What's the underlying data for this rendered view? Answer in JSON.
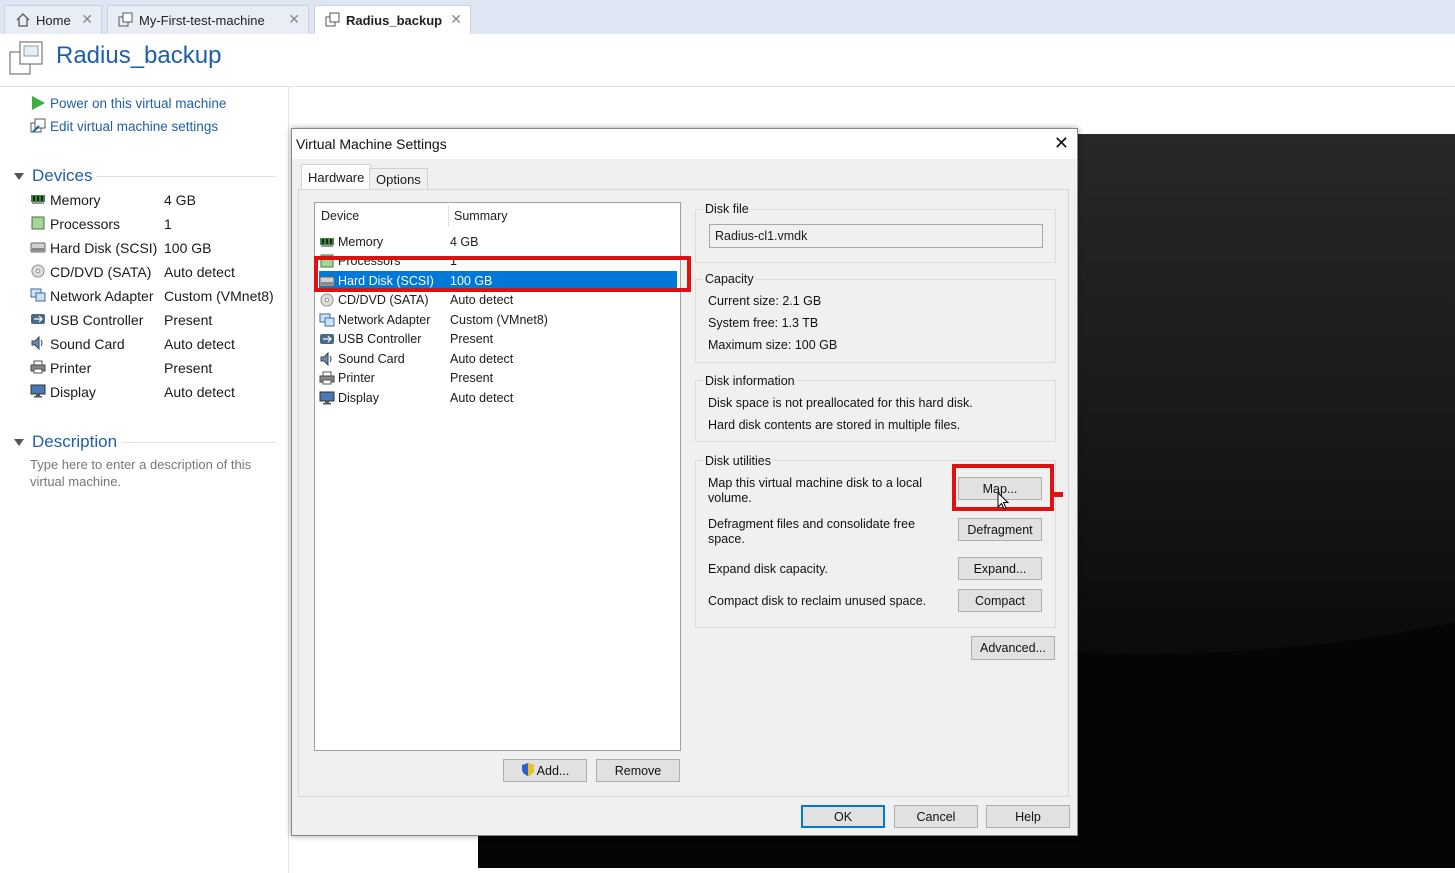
{
  "tabs": [
    {
      "label": "Home",
      "icon": "home-icon"
    },
    {
      "label": "My-First-test-machine",
      "icon": "vm-icon"
    },
    {
      "label": "Radius_backup",
      "icon": "vm-icon",
      "active": true
    }
  ],
  "vm_title": "Radius_backup",
  "actions": {
    "power_on": "Power on this virtual machine",
    "edit_settings": "Edit virtual machine settings"
  },
  "devices_section": {
    "title": "Devices",
    "items": [
      {
        "name": "Memory",
        "value": "4 GB",
        "icon": "memory-icon"
      },
      {
        "name": "Processors",
        "value": "1",
        "icon": "processor-icon"
      },
      {
        "name": "Hard Disk (SCSI)",
        "value": "100 GB",
        "icon": "hard-disk-icon"
      },
      {
        "name": "CD/DVD (SATA)",
        "value": "Auto detect",
        "icon": "cd-dvd-icon"
      },
      {
        "name": "Network Adapter",
        "value": "Custom (VMnet8)",
        "icon": "network-adapter-icon"
      },
      {
        "name": "USB Controller",
        "value": "Present",
        "icon": "usb-icon"
      },
      {
        "name": "Sound Card",
        "value": "Auto detect",
        "icon": "sound-card-icon"
      },
      {
        "name": "Printer",
        "value": "Present",
        "icon": "printer-icon"
      },
      {
        "name": "Display",
        "value": "Auto detect",
        "icon": "display-icon"
      }
    ]
  },
  "description_section": {
    "title": "Description",
    "placeholder": "Type here to enter a description of this virtual machine."
  },
  "dialog": {
    "title": "Virtual Machine Settings",
    "tabs": [
      "Hardware",
      "Options"
    ],
    "device_list": {
      "col_device": "Device",
      "col_summary": "Summary",
      "rows": [
        {
          "name": "Memory",
          "value": "4 GB"
        },
        {
          "name": "Processors",
          "value": "1"
        },
        {
          "name": "Hard Disk (SCSI)",
          "value": "100 GB",
          "selected": true
        },
        {
          "name": "CD/DVD (SATA)",
          "value": "Auto detect"
        },
        {
          "name": "Network Adapter",
          "value": "Custom (VMnet8)"
        },
        {
          "name": "USB Controller",
          "value": "Present"
        },
        {
          "name": "Sound Card",
          "value": "Auto detect"
        },
        {
          "name": "Printer",
          "value": "Present"
        },
        {
          "name": "Display",
          "value": "Auto detect"
        }
      ]
    },
    "add_button": "Add...",
    "remove_button": "Remove",
    "disk_file": {
      "label": "Disk file",
      "value": "Radius-cl1.vmdk"
    },
    "capacity": {
      "label": "Capacity",
      "current_size": "Current size:  2.1 GB",
      "system_free": "System free:  1.3 TB",
      "maximum_size": "Maximum size:  100 GB"
    },
    "disk_information": {
      "label": "Disk information",
      "line1": "Disk space is not preallocated for this hard disk.",
      "line2": "Hard disk contents are stored in multiple files."
    },
    "disk_utilities": {
      "label": "Disk utilities",
      "map_text": "Map this virtual machine disk to a local volume.",
      "map_button": "Map...",
      "defrag_text": "Defragment files and consolidate free space.",
      "defrag_button": "Defragment",
      "expand_text": "Expand disk capacity.",
      "expand_button": "Expand...",
      "compact_text": "Compact disk to reclaim unused space.",
      "compact_button": "Compact"
    },
    "advanced_button": "Advanced...",
    "ok_button": "OK",
    "cancel_button": "Cancel",
    "help_button": "Help"
  },
  "colors": {
    "accent": "#1f5fa8",
    "selection": "#0078d7",
    "highlight_box": "#e01010"
  }
}
